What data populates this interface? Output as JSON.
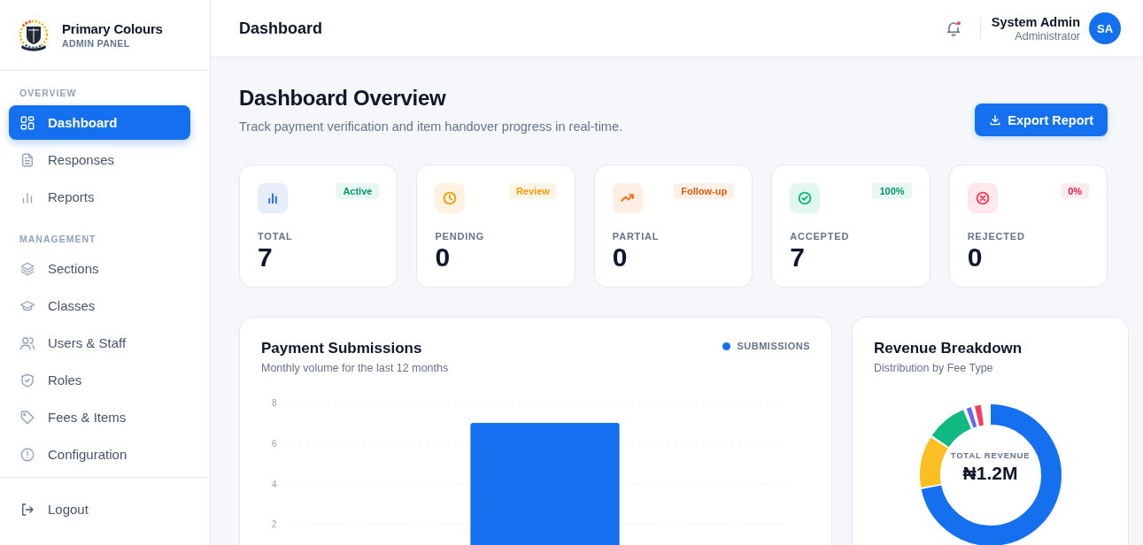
{
  "brand": {
    "name": "Primary Colours",
    "subtitle": "ADMIN PANEL"
  },
  "sidebar": {
    "sections": [
      {
        "title": "OVERVIEW",
        "items": [
          {
            "label": "Dashboard",
            "selected": true
          },
          {
            "label": "Responses",
            "selected": false
          },
          {
            "label": "Reports",
            "selected": false
          }
        ]
      },
      {
        "title": "MANAGEMENT",
        "items": [
          {
            "label": "Sections",
            "selected": false
          },
          {
            "label": "Classes",
            "selected": false
          },
          {
            "label": "Users & Staff",
            "selected": false
          },
          {
            "label": "Roles",
            "selected": false
          },
          {
            "label": "Fees & Items",
            "selected": false
          },
          {
            "label": "Configuration",
            "selected": false
          }
        ]
      }
    ],
    "logout": "Logout"
  },
  "header": {
    "title": "Dashboard",
    "user_name": "System Admin",
    "user_role": "Administrator",
    "avatar_initials": "SA"
  },
  "overview": {
    "title": "Dashboard Overview",
    "subtitle": "Track payment verification and item handover progress in real-time.",
    "export_button": "Export Report"
  },
  "stats": [
    {
      "label": "TOTAL",
      "value": "7",
      "badge": "Active",
      "color": "#2f6fe4"
    },
    {
      "label": "PENDING",
      "value": "0",
      "badge": "Review",
      "color": "#f59e0b"
    },
    {
      "label": "PARTIAL",
      "value": "0",
      "badge": "Follow-up",
      "color": "#f97316"
    },
    {
      "label": "ACCEPTED",
      "value": "7",
      "badge": "100%",
      "color": "#10b981"
    },
    {
      "label": "REJECTED",
      "value": "0",
      "badge": "0%",
      "color": "#f43f5e"
    }
  ],
  "payment_chart": {
    "title": "Payment Submissions",
    "subtitle": "Monthly volume for the last 12 months",
    "chart_data": {
      "type": "bar",
      "series": [
        {
          "name": "SUBMISSIONS",
          "color": "#1570ef",
          "values": [
            7
          ]
        }
      ],
      "grid": true,
      "ylim": [
        0,
        8
      ],
      "yticks": [
        2,
        4,
        6,
        8
      ]
    }
  },
  "revenue": {
    "title": "Revenue Breakdown",
    "subtitle": "Distribution by Fee Type",
    "center_label": "TOTAL REVENUE",
    "center_value": "₦1.2M"
  }
}
